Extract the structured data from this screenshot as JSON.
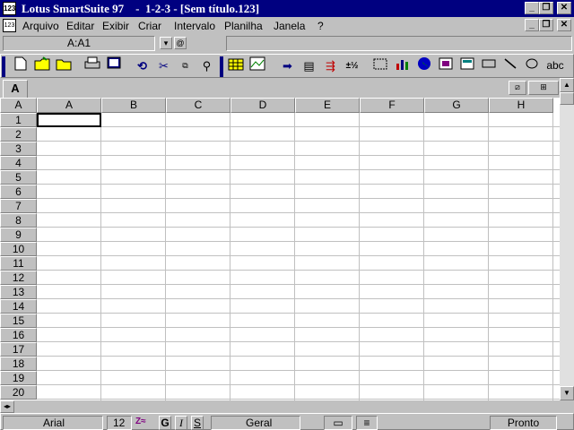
{
  "window": {
    "title": "Lotus SmartSuite 97    -  1-2-3 - [Sem título.123]",
    "app_icon": "lotus-app-icon",
    "controls": [
      "_",
      "❐",
      "✕"
    ]
  },
  "menu": {
    "doc_icon": "123",
    "items": [
      "Arquivo",
      "Editar",
      "Exibir",
      "Criar",
      "Intervalo",
      "Planilha",
      "Janela",
      "?"
    ],
    "doc_controls": [
      "_",
      "❐",
      "✕"
    ]
  },
  "editline": {
    "cell_reference": "A:A1",
    "contents": ""
  },
  "toolbar": {
    "icons": [
      "new-file-icon",
      "open-file-icon",
      "open-folder-icon",
      "print-icon",
      "print-preview-icon",
      "undo-icon",
      "cut-icon",
      "copy-paste-icon",
      "paste-format-icon",
      "insert-range-icon",
      "chart-icon",
      "arrow-right-icon",
      "sort-icon",
      "fill-icon",
      "fraction-icon",
      "select-icon",
      "bar-chart-icon",
      "globe-icon",
      "image-icon",
      "form-icon",
      "rectangle-icon",
      "line-icon",
      "ellipse-icon",
      "text-icon"
    ],
    "fraction_label": "±½",
    "text_label": "abc"
  },
  "sheet": {
    "tab_label": "A",
    "corner_label": "A",
    "columns": [
      "A",
      "B",
      "C",
      "D",
      "E",
      "F",
      "G",
      "H"
    ],
    "rows": [
      "1",
      "2",
      "3",
      "4",
      "5",
      "6",
      "7",
      "8",
      "9",
      "10",
      "11",
      "12",
      "13",
      "14",
      "15",
      "16",
      "17",
      "18",
      "19",
      "20"
    ]
  },
  "status": {
    "font": "Arial",
    "size": "12",
    "bold": "G",
    "italic": "I",
    "underline": "S",
    "format": "Geral",
    "mode": "Pronto"
  }
}
